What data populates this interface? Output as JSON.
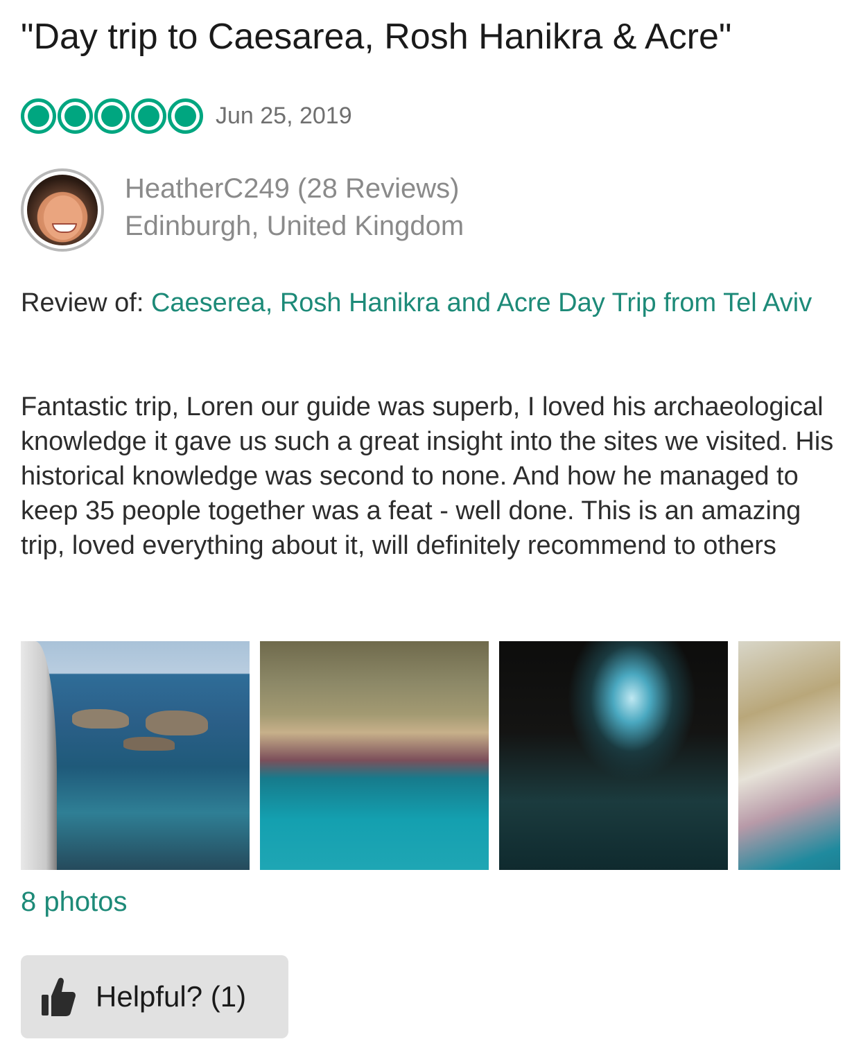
{
  "review": {
    "title": "\"Day trip to Caesarea, Rosh Hanikra & Acre\"",
    "rating": 5,
    "rating_max": 5,
    "date": "Jun 25, 2019",
    "accent_color": "#00a680",
    "link_color": "#1d8a78"
  },
  "reviewer": {
    "name_line": "HeatherC249 (28 Reviews)",
    "location": "Edinburgh, United Kingdom",
    "avatar_icon": "profile-photo"
  },
  "review_of": {
    "label": "Review of: ",
    "link_text": "Caeserea, Rosh Hanikra and Acre Day Trip from Tel Aviv"
  },
  "body": "Fantastic trip, Loren our guide was superb, I loved his archaeological knowledge it gave us such a great insight into the sites we visited. His historical knowledge was second to none. And how he managed to keep 35 people together was a feat - well done. This is an amazing trip, loved everything about it, will definitely recommend to others",
  "photos": {
    "count_label": "8 photos"
  },
  "helpful": {
    "label": "Helpful? (1)",
    "icon": "thumbs-up-icon"
  }
}
